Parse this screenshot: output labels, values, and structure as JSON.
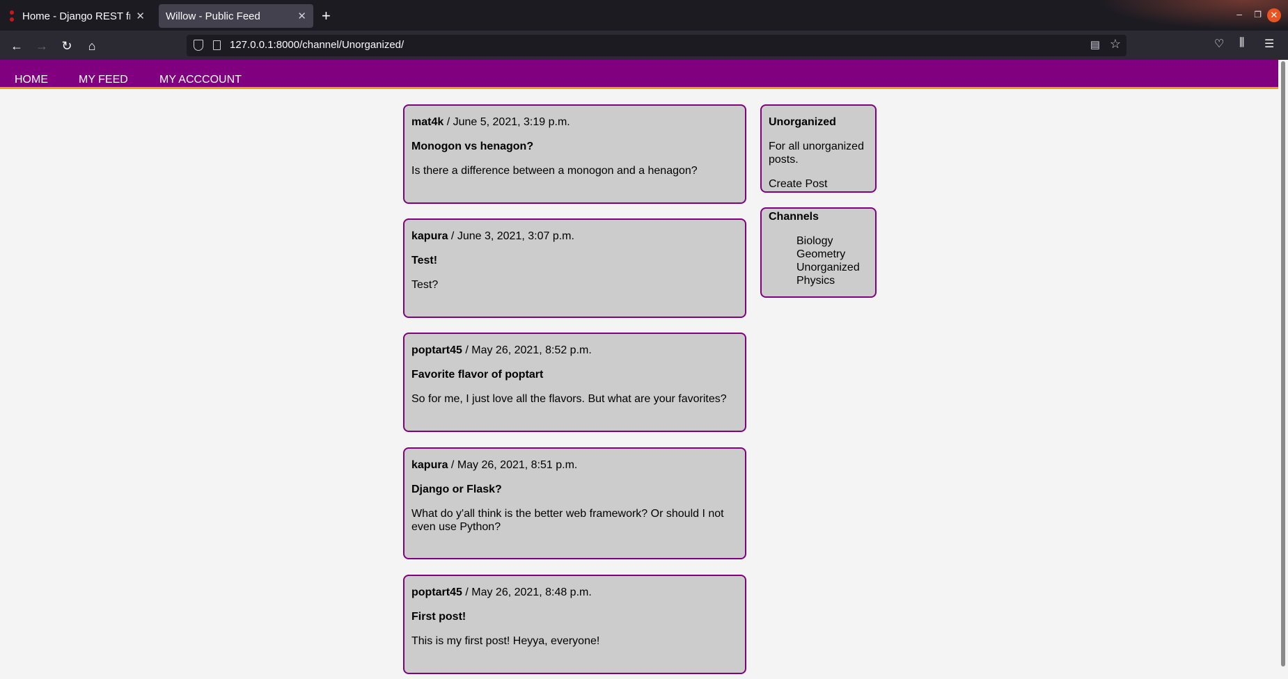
{
  "browser": {
    "tabs": [
      {
        "label": "Home - Django REST framework",
        "active": false
      },
      {
        "label": "Willow - Public Feed",
        "active": true
      }
    ],
    "url": "127.0.0.1:8000/channel/Unorganized/"
  },
  "site_nav": {
    "links": [
      "HOME",
      "MY FEED",
      "MY ACCCOUNT"
    ]
  },
  "posts": [
    {
      "author": "mat4k",
      "date": "/ June 5, 2021, 3:19 p.m.",
      "title": "Monogon vs henagon?",
      "body": "Is there a difference between a monogon and a henagon?"
    },
    {
      "author": "kapura",
      "date": "/ June 3, 2021, 3:07 p.m.",
      "title": "Test!",
      "body": "Test?"
    },
    {
      "author": "poptart45",
      "date": "/ May 26, 2021, 8:52 p.m.",
      "title": "Favorite flavor of poptart",
      "body": "So for me, I just love all the flavors. But what are your favorites?"
    },
    {
      "author": "kapura",
      "date": "/ May 26, 2021, 8:51 p.m.",
      "title": "Django or Flask?",
      "body": "What do y'all think is the better web framework? Or should I not even use Python?"
    },
    {
      "author": "poptart45",
      "date": "/ May 26, 2021, 8:48 p.m.",
      "title": "First post!",
      "body": "This is my first post! Heyya, everyone!"
    }
  ],
  "channel_info": {
    "name": "Unorganized",
    "description": "For all unorganized posts.",
    "create_label": "Create Post"
  },
  "channels": {
    "heading": "Channels",
    "items": [
      "Biology",
      "Geometry",
      "Unorganized",
      "Physics"
    ]
  },
  "colors": {
    "accent": "#800080",
    "nav_underline": "#e8a300",
    "card_bg": "#cccccc"
  }
}
